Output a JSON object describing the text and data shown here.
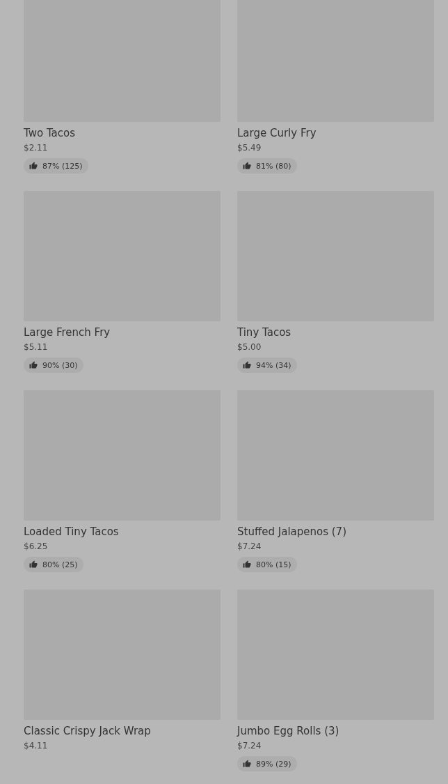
{
  "menu_items": [
    {
      "name": "Two Tacos",
      "price": "$2.11",
      "rating": "87% (125)"
    },
    {
      "name": "Large Curly Fry",
      "price": "$5.49",
      "rating": "81% (80)"
    },
    {
      "name": "Large French Fry",
      "price": "$5.11",
      "rating": "90% (30)"
    },
    {
      "name": "Tiny Tacos",
      "price": "$5.00",
      "rating": "94% (34)"
    },
    {
      "name": "Loaded Tiny Tacos",
      "price": "$6.25",
      "rating": "80% (25)"
    },
    {
      "name": "Stuffed Jalapenos (7)",
      "price": "$7.24",
      "rating": "80% (15)"
    },
    {
      "name": "Classic Crispy Jack Wrap",
      "price": "$4.11"
    },
    {
      "name": "Jumbo Egg Rolls (3)",
      "price": "$7.24",
      "rating": "89% (29)"
    }
  ]
}
